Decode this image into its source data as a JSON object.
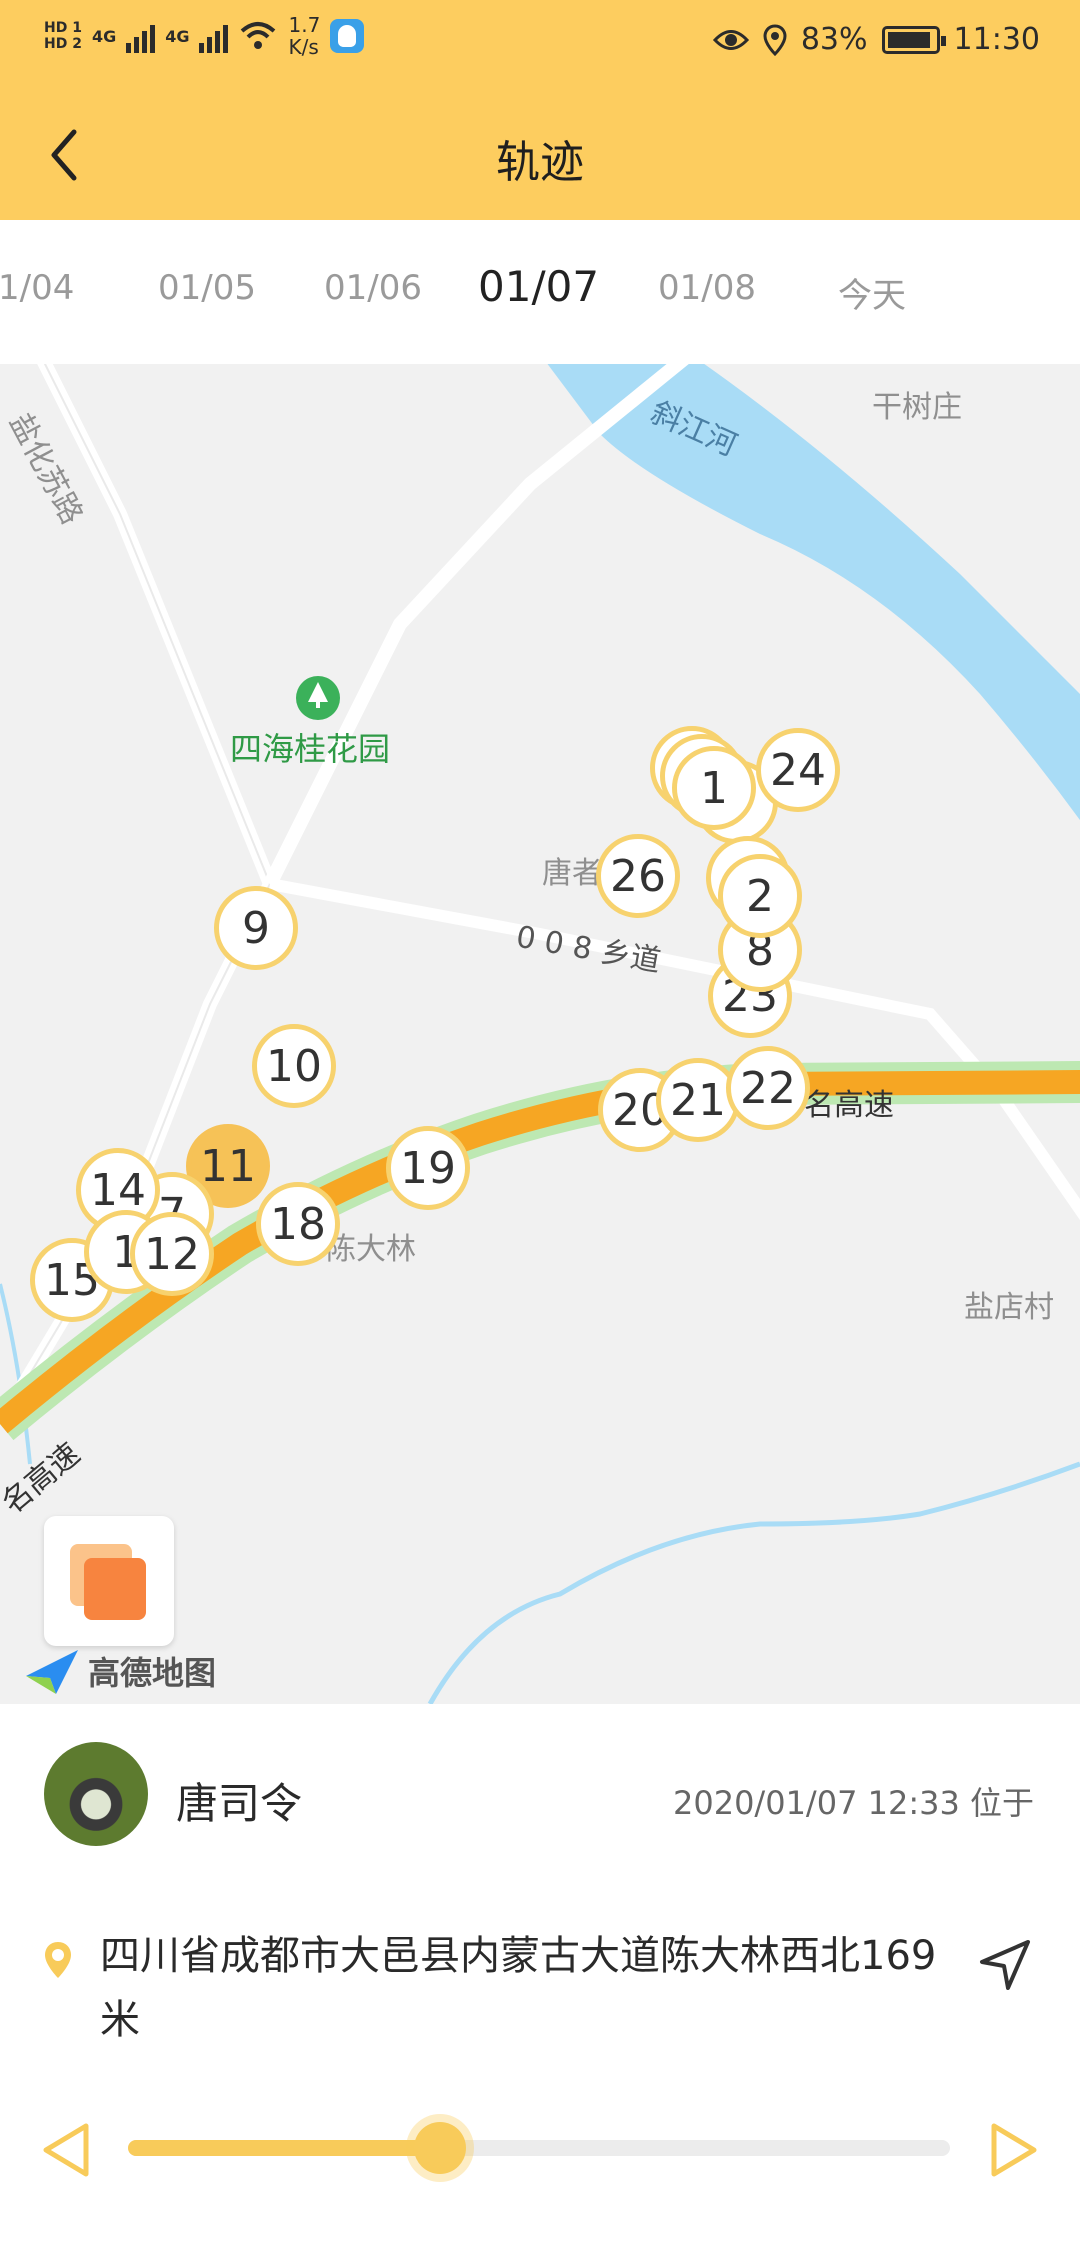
{
  "status_bar": {
    "hd1": "HD 1",
    "hd2": "HD 2",
    "net1": "4G",
    "net2": "4G",
    "speed_value": "1.7",
    "speed_unit": "K/s",
    "battery": "83%",
    "time": "11:30"
  },
  "header": {
    "title": "轨迹"
  },
  "tabs": [
    "1/04",
    "01/05",
    "01/06",
    "01/07",
    "01/08",
    "今天"
  ],
  "active_tab": "01/07",
  "map": {
    "labels": {
      "road_yanhua": "盐化苏路",
      "river": "斜江河",
      "ganshu": "干树庄",
      "park": "四海桂花园",
      "tang": "唐者",
      "road_008": "0 0 8 乡道",
      "highway_right": "名高速",
      "chendalin": "陈大林",
      "yandian": "盐店村",
      "highway_left": "名高速"
    },
    "pins": [
      "1",
      "24",
      "26",
      "2",
      "8",
      "23",
      "9",
      "10",
      "11",
      "14",
      "7",
      "1",
      "12",
      "15",
      "18",
      "19",
      "20",
      "21",
      "22"
    ],
    "highlight_pin": "11",
    "brand": "高德地图"
  },
  "card": {
    "name": "唐司令",
    "timestamp": "2020/01/07 12:33 位于",
    "address": "四川省成都市大邑县内蒙古大道陈大林西北169米"
  },
  "playback": {
    "progress": 0.38
  },
  "colors": {
    "accent": "#FDCD5F",
    "pin_border": "#F7D26E",
    "highway": "#F6A623",
    "river": "#A9DCF6"
  }
}
